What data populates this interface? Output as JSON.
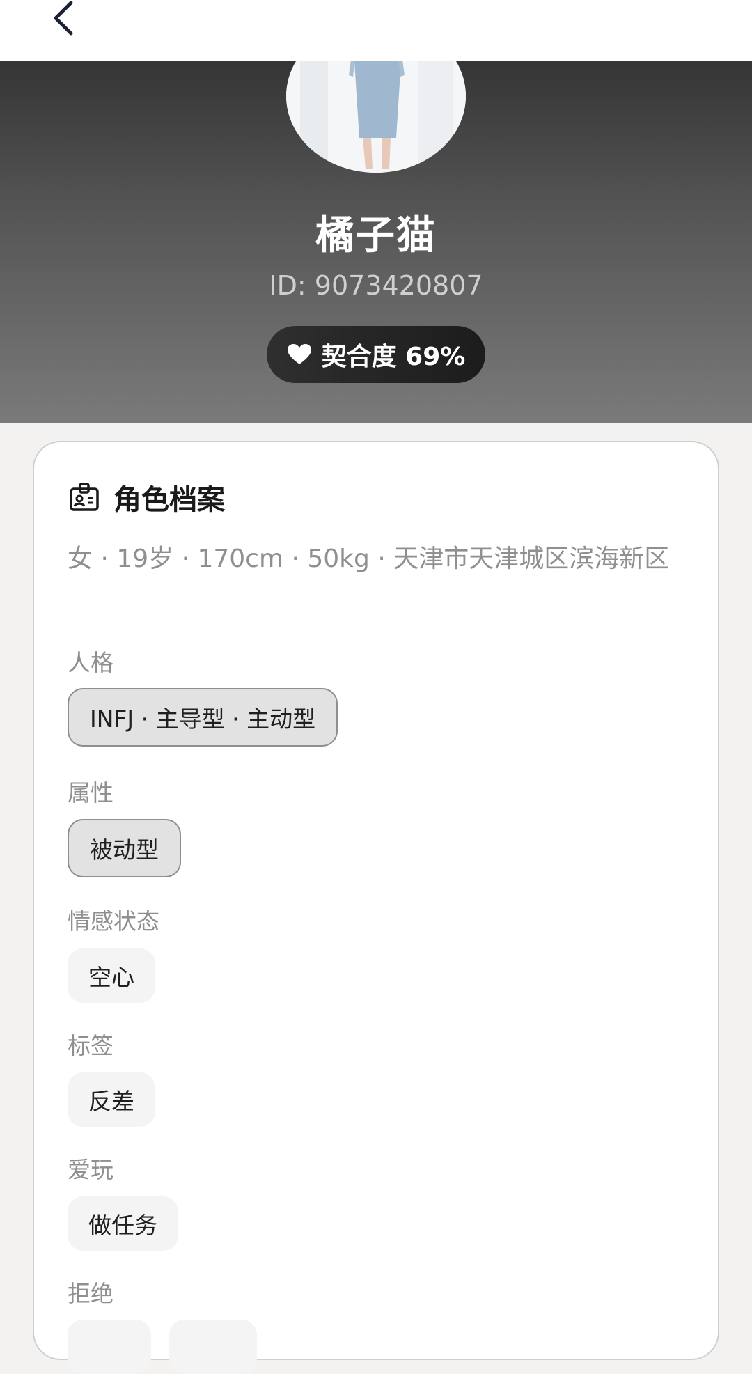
{
  "nav": {
    "back_icon": "chevron-left-icon"
  },
  "profile": {
    "name": "橘子猫",
    "id_text": "ID: 9073420807",
    "match_icon": "heart-icon",
    "match_label": "契合度 69%",
    "match_percent": 69
  },
  "card": {
    "icon": "id-card-icon",
    "title": "角色档案",
    "basic_info": "女 · 19岁 · 170cm · 50kg · 天津市天津城区滨海新区",
    "sections": [
      {
        "label": "人格",
        "tags": [
          "INFJ · 主导型 · 主动型"
        ]
      },
      {
        "label": "属性",
        "tags": [
          "被动型"
        ]
      },
      {
        "label": "情感状态",
        "tags": [
          "空心"
        ]
      },
      {
        "label": "标签",
        "tags": [
          "反差"
        ]
      },
      {
        "label": "爱玩",
        "tags": [
          "做任务"
        ]
      },
      {
        "label": "拒绝",
        "tags": []
      }
    ]
  },
  "colors": {
    "hero_top": "#353536",
    "hero_bottom": "#7a7a7a",
    "badge_bg": "#1c1c1c",
    "page_bg": "#f3f2f1"
  }
}
